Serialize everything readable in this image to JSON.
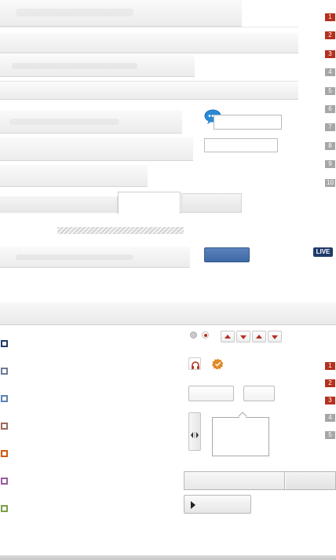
{
  "ranking_top": [
    "1",
    "2",
    "3",
    "4",
    "5",
    "6",
    "7",
    "8",
    "9",
    "10"
  ],
  "ranking_bottom": [
    "1",
    "2",
    "3",
    "4",
    "5"
  ],
  "live_badge": "LIVE",
  "chat_icon_glyph": "···",
  "colors": {
    "accent_red": "#b5301f",
    "rank_gray": "#a6a6a6",
    "button_blue": "#3f6aa6",
    "live_navy": "#1f3c6b",
    "list_markers": [
      "#1f3c6b",
      "#6d7b96",
      "#5a84b5",
      "#9b6a5a",
      "#d35a12",
      "#9a5aa0",
      "#7aa04a"
    ]
  },
  "icons": {
    "chat": "speech-bubble-icon",
    "headphones": "headphones-icon",
    "badge": "verified-badge-icon",
    "play": "play-icon",
    "split": "split-handle-icon"
  }
}
